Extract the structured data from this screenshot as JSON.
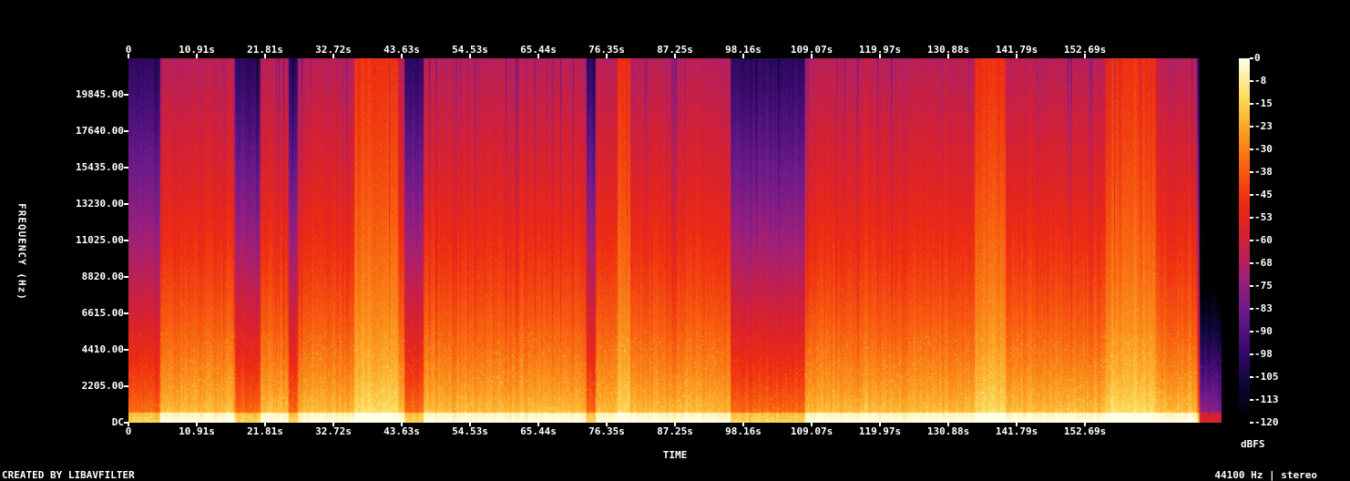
{
  "chart_data": {
    "type": "heatmap",
    "x_axis": {
      "title": "TIME",
      "ticks": [
        "0",
        "10.91s",
        "21.81s",
        "32.72s",
        "43.63s",
        "54.53s",
        "65.44s",
        "76.35s",
        "87.25s",
        "98.16s",
        "109.07s",
        "119.97s",
        "130.88s",
        "141.79s",
        "152.69s"
      ],
      "tick_values_s": [
        0,
        10.91,
        21.81,
        32.72,
        43.63,
        54.53,
        65.44,
        76.35,
        87.25,
        98.16,
        109.07,
        119.97,
        130.88,
        141.79,
        152.69
      ],
      "range_s": [
        0,
        174.5
      ]
    },
    "y_axis": {
      "title": "FREQUENCY (Hz)",
      "ticks": [
        "DC",
        "2205.00",
        "4410.00",
        "6615.00",
        "8820.00",
        "11025.00",
        "13230.00",
        "15435.00",
        "17640.00",
        "19845.00"
      ],
      "tick_values_hz": [
        0,
        2205,
        4410,
        6615,
        8820,
        11025,
        13230,
        15435,
        17640,
        19845
      ],
      "range_hz": [
        0,
        22050
      ]
    },
    "colorbar": {
      "unit": "dBFS",
      "ticks": [
        "0",
        "-8",
        "-15",
        "-23",
        "-30",
        "-38",
        "-45",
        "-53",
        "-60",
        "-68",
        "-75",
        "-83",
        "-90",
        "-98",
        "-105",
        "-113",
        "-120"
      ],
      "range_db": [
        -120,
        0
      ],
      "colors": [
        "#000000",
        "#0c0836",
        "#3a0a6e",
        "#6a1a8c",
        "#a0207a",
        "#d0203a",
        "#ee2a12",
        "#f86010",
        "#fca020",
        "#fde060",
        "#ffffe8"
      ]
    },
    "quiet_segments_s": [
      [
        0,
        5
      ],
      [
        17,
        21
      ],
      [
        25.5,
        27
      ],
      [
        44,
        47
      ],
      [
        73,
        74.5
      ],
      [
        96,
        108
      ],
      [
        170.5,
        174.5
      ]
    ],
    "loud_segments_s": [
      [
        36,
        43
      ],
      [
        78,
        80
      ],
      [
        135,
        140
      ],
      [
        156,
        164
      ]
    ]
  },
  "footer": {
    "left": "CREATED BY LIBAVFILTER",
    "right": "44100 Hz | stereo"
  }
}
